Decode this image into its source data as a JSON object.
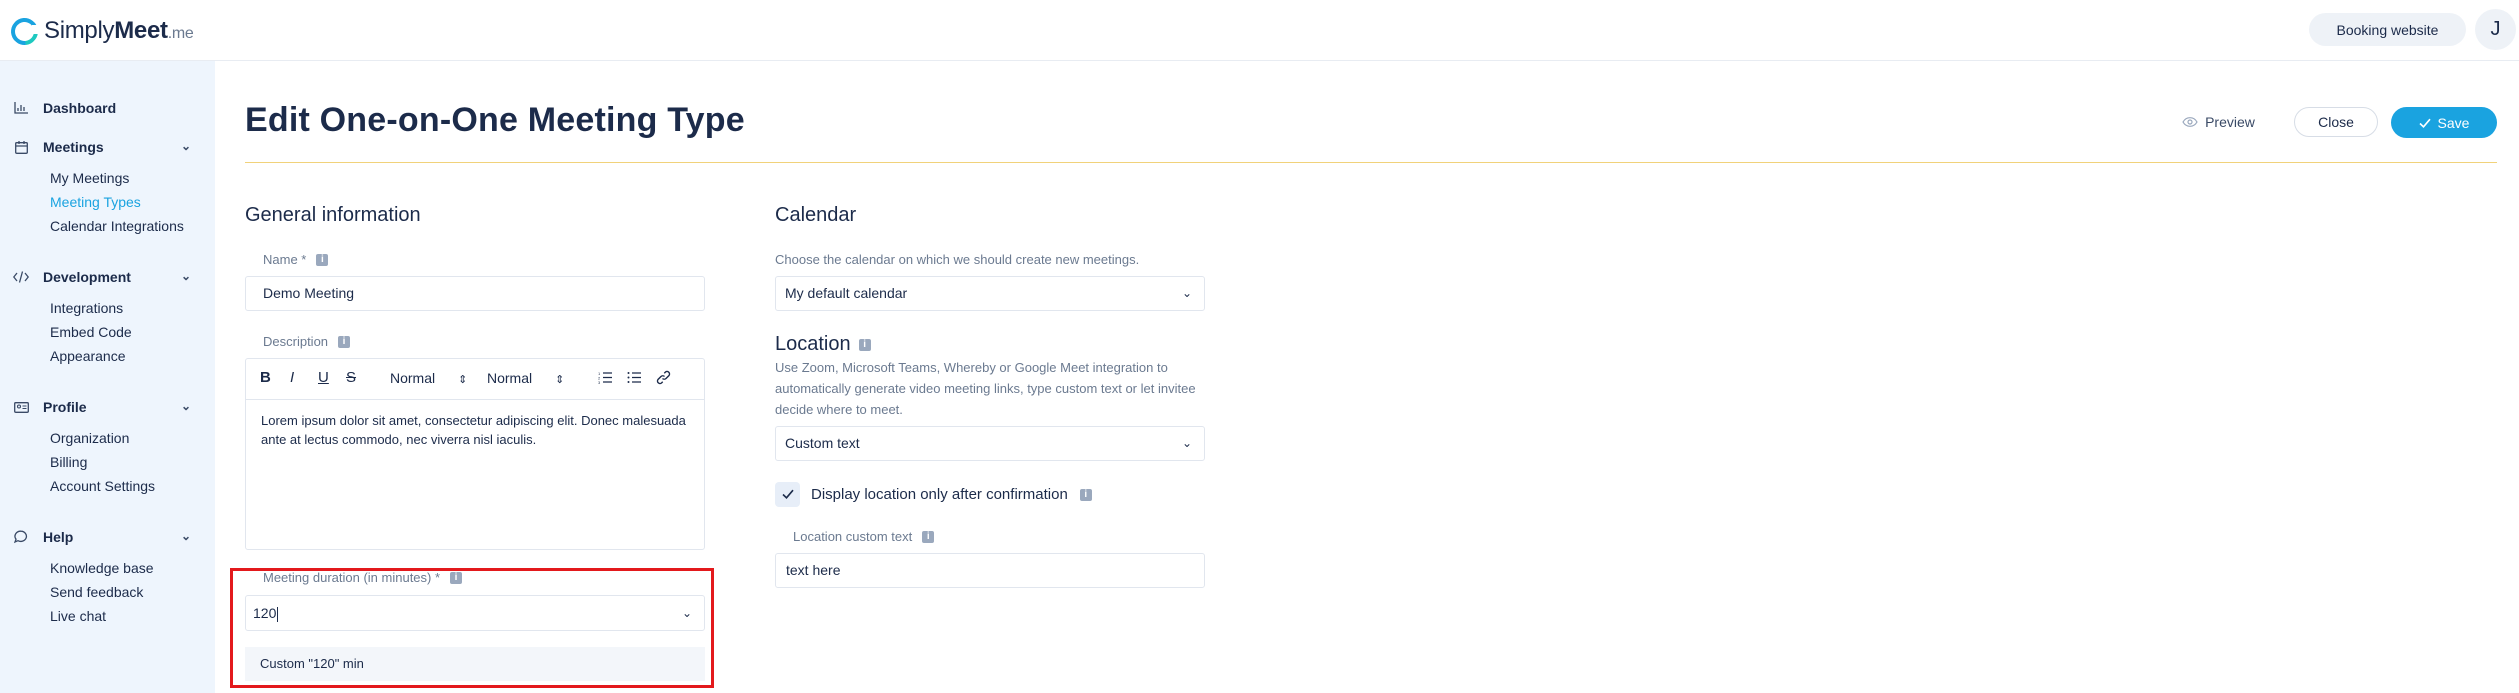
{
  "header": {
    "logo_main": "Simply",
    "logo_bold": "Meet",
    "logo_suffix": ".me",
    "booking_button": "Booking website",
    "avatar_letter": "J"
  },
  "sidebar": {
    "dashboard": "Dashboard",
    "meetings": {
      "label": "Meetings",
      "items": [
        "My Meetings",
        "Meeting Types",
        "Calendar Integrations"
      ]
    },
    "development": {
      "label": "Development",
      "items": [
        "Integrations",
        "Embed Code",
        "Appearance"
      ]
    },
    "profile": {
      "label": "Profile",
      "items": [
        "Organization",
        "Billing",
        "Account Settings"
      ]
    },
    "help": {
      "label": "Help",
      "items": [
        "Knowledge base",
        "Send feedback",
        "Live chat"
      ]
    }
  },
  "page": {
    "title": "Edit One-on-One Meeting Type",
    "preview": "Preview",
    "close": "Close",
    "save": "Save"
  },
  "general": {
    "title": "General information",
    "name_label": "Name *",
    "name_value": "Demo Meeting",
    "description_label": "Description",
    "toolbar": {
      "bold": "B",
      "italic": "I",
      "underline": "U",
      "strike": "S",
      "font": "Normal",
      "size": "Normal"
    },
    "description_text": "Lorem ipsum dolor sit amet, consectetur adipiscing elit. Donec malesuada ante at lectus commodo, nec viverra nisl iaculis.",
    "duration_label": "Meeting duration (in minutes) *",
    "duration_value": "120",
    "duration_option": "Custom \"120\" min"
  },
  "calendar": {
    "title": "Calendar",
    "help": "Choose the calendar on which we should create new meetings.",
    "value": "My default calendar"
  },
  "location": {
    "title": "Location",
    "help": "Use Zoom, Microsoft Teams, Whereby or Google Meet integration to automatically generate video meeting links, type custom text or let invitee decide where to meet.",
    "value": "Custom text",
    "checkbox_label": "Display location only after confirmation",
    "custom_label": "Location custom text",
    "custom_value": "text here"
  },
  "colors": {
    "accent": "#1aa3e0",
    "highlight": "#e3191c",
    "rule": "#f1d27a",
    "sidebar_bg": "#eef5fd"
  }
}
